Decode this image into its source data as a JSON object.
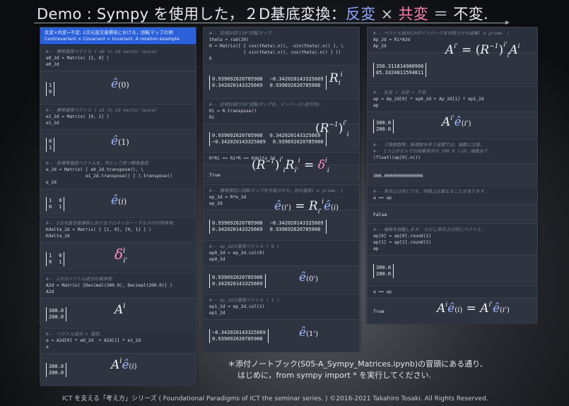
{
  "title": {
    "prefix": "Demo : Sympy を使用した，２D基底変換：",
    "hanpen": "反変",
    "times": "×",
    "kyohen": "共変",
    "eq": "＝",
    "fuhen": "不変."
  },
  "col1": {
    "header": [
      "反変×共変=不変: 2次元直交座標系における，回転マップの例",
      "Contravariant × Covariant = Invariant. A rotation example."
    ],
    "cells": [
      {
        "code": [
          "#-- 標準基底ベクトル ( e0 in 2d vector space)",
          "e0_2d = Matrix( [1, 0] )",
          "e0_2d"
        ],
        "matrix": [
          [
            "1"
          ],
          [
            "0"
          ]
        ],
        "label": "ê(0)"
      },
      {
        "code": [
          "#-- 標準基底ベクトル ( e1 in 2d vector space)",
          "e1_2d = Matrix( [0, 1] )",
          "e1_2d"
        ],
        "matrix": [
          [
            "0"
          ],
          [
            "1"
          ]
        ],
        "label": "ê(1)"
      },
      {
        "code": [
          "#-- 各標準基底ベクトルを，列として持つ標準基底.",
          "e_2d = Matrix( [ e0_2d.transpose(), \\",
          "               e1_2d.transpose() ] ).transpose()",
          "e_2d"
        ],
        "matrix": [
          [
            "1",
            "0"
          ],
          [
            "0",
            "1"
          ]
        ],
        "label": "ê(i)"
      },
      {
        "code": [
          "#-- 2次元直交座標系におけるクロネッカー・デルタの行列表現.",
          "Kdelta_2d = Matrix( [ [1, 0], [0, 1] ] )",
          "Kdelta_2d"
        ],
        "matrix": [
          [
            "1",
            "0"
          ],
          [
            "0",
            "1"
          ]
        ],
        "label": "δ^i_i'"
      },
      {
        "code": [
          "#-- 2次元ベクトル成分の具体例.",
          "A2d = Matrix( [Decimal(300.0), Decimal(200.0)] )",
          "A2d"
        ],
        "matrix": [
          [
            "300.0"
          ],
          [
            "200.0"
          ]
        ],
        "label": "A^i"
      },
      {
        "code": [
          "#-- ベクトル成分 × 基底.",
          "a = A2d[0] * e0_2d  + A2d[1] * e1_2d",
          "a"
        ],
        "matrix": [
          [
            "300.0"
          ],
          [
            "200.0"
          ]
        ],
        "label": "A^i ê(i)"
      }
    ]
  },
  "col2": {
    "cells": [
      {
        "code": [
          "#-- 反時計回り20°回転マップ.",
          "theta = rad(20)",
          "R = Matrix([ [ cos(theta).n(), -sin(theta).n() ], \\",
          "             [ sin(theta).n(), cos(theta).n() ] ])",
          "R"
        ],
        "matrix": [
          [
            "0.939692620785908",
            "−0.342020143325669"
          ],
          [
            "0.342020143325669",
            "0.939692620785908"
          ]
        ],
        "label": "R_i^i'"
      },
      {
        "code": [
          "#-- 反時計回り20°回転マップの，インバース(逆行列).",
          "Ri = R.transpose()",
          "Ri"
        ],
        "matrix": [
          [
            "0.939692620785908",
            "0.342020143325669"
          ],
          [
            "−0.342020143325669",
            "0.939692620785908"
          ]
        ],
        "label": "(R^-1)^i'_i"
      },
      {
        "code": [
          "R*Ri == Ri*R == Kdelta_2d"
        ],
        "text": "True",
        "label": "(R^-1)^i'_i R_i'^i = δ^i_i'"
      },
      {
        "code": [
          "#-- 標準規定に回転マップを作用させた，別の基底( e prime. )",
          "ep_2d = R*e_2d",
          "ep_2d"
        ],
        "matrix": [
          [
            "0.939692620785908",
            "−0.342020143325669"
          ],
          [
            "0.342020143325669",
            "0.939692620785908"
          ]
        ],
        "label": "ê(i') = R_i'^i ê(i)"
      },
      {
        "code": [
          "#-- ep_2dの基底ベクトル ( 0 )",
          "ep0_2d = ep_2d.col(0)",
          "ep0_2d"
        ],
        "matrix": [
          [
            "0.939692620785908"
          ],
          [
            "0.342020143325669"
          ]
        ],
        "label": "ê(0')"
      },
      {
        "code": [
          "#-- ep_2dの基底ベクトル ( 1 )",
          "ep1_2d = ep_2d.col(1)",
          "ep1_2d"
        ],
        "matrix": [
          [
            "−0.342020143325669"
          ],
          [
            "0.939692620785908"
          ]
        ],
        "label": "ê(1')"
      }
    ]
  },
  "col3": {
    "cells": [
      {
        "code": [
          "#-- ベクトル成分にRのインバースを作用させた結果( A prime. )",
          "Ap_2d = Ri*A2d",
          "Ap_2d"
        ],
        "matrix": [
          [
            "350.311814900906"
          ],
          [
            "85.3324811594811"
          ]
        ],
        "label": "A^i' = (R^-1)^i'_i A^i"
      },
      {
        "code": [
          "#-- 反変 × 共変 = 不変.",
          "ap = Ap_2d[0] * ep0_2d + Ap_2d[1] * ep1_2d",
          "ap"
        ],
        "matrix": [
          [
            "300.0"
          ],
          [
            "200.0"
          ]
        ],
        "label": "A^i' ê(i')"
      },
      {
        "code": [
          "#-- 三角関数等，無理数を伴う演算では，端数に注意.",
          "#-- 1つ上のセルでの結果表示の 300.0 には，端数あり.",
          "(float)(ap[0].n())"
        ],
        "text": "300.00000000000006"
      },
      {
        "code": [
          "#-- 表示上は同じでも，評価上は異なることがあります.",
          "a == ap"
        ],
        "text": "False"
      },
      {
        "code": [
          "#-- 端数を調整します. ただし表示上は同じベクトル.",
          "ap[0] = ap[0].round(1)",
          "ap[1] = ap[1].round(1)",
          "ap"
        ],
        "matrix": [
          [
            "300.0"
          ],
          [
            "200.0"
          ]
        ]
      },
      {
        "code": [
          "a == ap"
        ],
        "text": "True",
        "label": "A^i ê(i) = A^i' ê(i')"
      }
    ]
  },
  "note": [
    "＊添付ノートブック(S05-A_Sympy_Matrices.ipynb)の冒頭にある通り,",
    "はじめに，from sympy import * を実行してください."
  ],
  "footer": "ICT を支える「考え方」シリーズ ( Foundational Paradigms of ICT the seminar series. ) ©2016-2021 Takahiro Tosaki. All Rights Reserved."
}
